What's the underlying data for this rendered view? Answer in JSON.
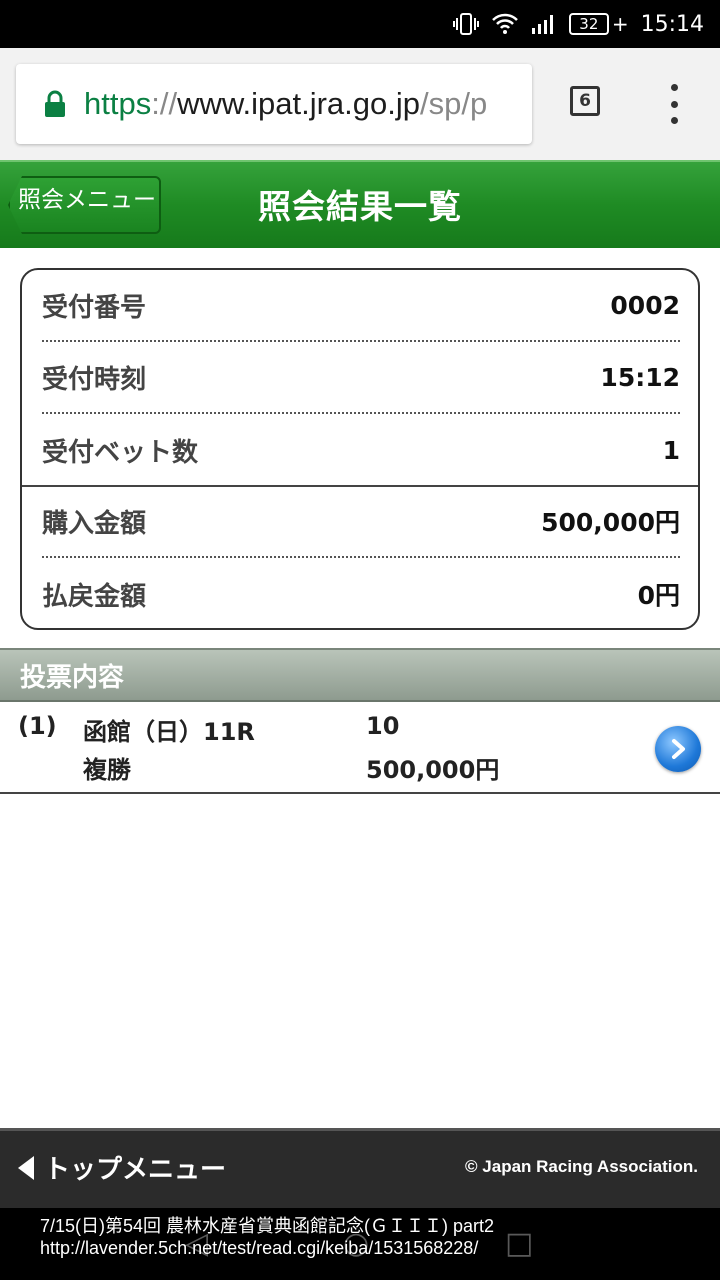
{
  "status_bar": {
    "battery": "32",
    "time": "15:14"
  },
  "browser": {
    "url_scheme": "https",
    "url_sep": "://",
    "url_host": "www.ipat.jra.go.jp",
    "url_path": "/sp/p",
    "tab_count": "6"
  },
  "header": {
    "back_label": "照会メニュー",
    "title": "照会結果一覧"
  },
  "summary": {
    "rows": [
      {
        "label": "受付番号",
        "value": "0002"
      },
      {
        "label": "受付時刻",
        "value": "15:12"
      },
      {
        "label": "受付ベット数",
        "value": "1"
      },
      {
        "label": "購入金額",
        "value": "500,000円"
      },
      {
        "label": "払戻金額",
        "value": "0円"
      }
    ]
  },
  "bets": {
    "section_title": "投票内容",
    "items": [
      {
        "index": "(1)",
        "venue": "函館（日）11R",
        "type": "複勝",
        "selection": "10",
        "amount": "500,000円"
      }
    ]
  },
  "footer": {
    "top_menu": "トップメニュー",
    "copyright": "© Japan Racing Association."
  },
  "caption": {
    "line1": "7/15(日)第54回 農林水産省賞典函館記念(ＧＩＩＩ) part2",
    "line2": "http://lavender.5ch.net/test/read.cgi/keiba/1531568228/"
  }
}
